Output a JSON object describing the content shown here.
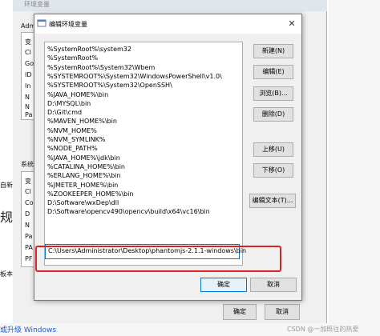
{
  "background_window": {
    "title": "环境变量",
    "user_section_label": "Adm",
    "user_var_fragments": [
      "变",
      "Cl",
      "Go",
      "ID",
      "In",
      "N",
      "N",
      "Pa"
    ],
    "system_section_label": "系统",
    "system_var_fragments": [
      "变",
      "Cl",
      "Co",
      "D",
      "N",
      "Pa",
      "PA",
      "PF"
    ],
    "left_fragments": [
      "自新",
      "规",
      "板本"
    ],
    "ok_label": "确定",
    "cancel_label": "取消",
    "bottom_link": "或升级 Windows",
    "watermark": "CSDN @一加既往的热爱"
  },
  "dialog": {
    "title": "编辑环境变量",
    "close_glyph": "✕",
    "path_entries": [
      "%SystemRoot%\\system32",
      "%SystemRoot%",
      "%SystemRoot%\\System32\\Wbem",
      "%SYSTEMROOT%\\System32\\WindowsPowerShell\\v1.0\\",
      "%SYSTEMROOT%\\System32\\OpenSSH\\",
      "%JAVA_HOME%\\bin",
      "D:\\MYSQL\\bin",
      "D:\\Git\\cmd",
      "%MAVEN_HOME%\\bin",
      "%NVM_HOME%",
      "%NVM_SYMLINK%",
      "%NODE_PATH%",
      "%JAVA_HOME%\\jdk\\bin",
      "%CATALINA_HOME%\\bin",
      "%ERLANG_HOME%\\bin",
      "%JMETER_HOME%\\bin",
      "%ZOOKEEPER_HOME%\\bin",
      "D:\\Software\\wxDep\\dll",
      "D:\\Software\\opencv490\\opencv\\build\\x64\\vc16\\bin"
    ],
    "editing_entry": "C:\\Users\\Administrator\\Desktop\\phantomjs-2.1.1-windows\\bin",
    "buttons": {
      "new": "新建(N)",
      "edit": "编辑(E)",
      "browse": "浏览(B)...",
      "delete": "删除(D)",
      "move_up": "上移(U)",
      "move_down": "下移(O)",
      "edit_text": "编辑文本(T)...",
      "ok": "确定",
      "cancel": "取消"
    }
  },
  "colors": {
    "highlight_border": "#e02020",
    "focus_border": "#0078d7",
    "link": "#1e5bd7"
  }
}
